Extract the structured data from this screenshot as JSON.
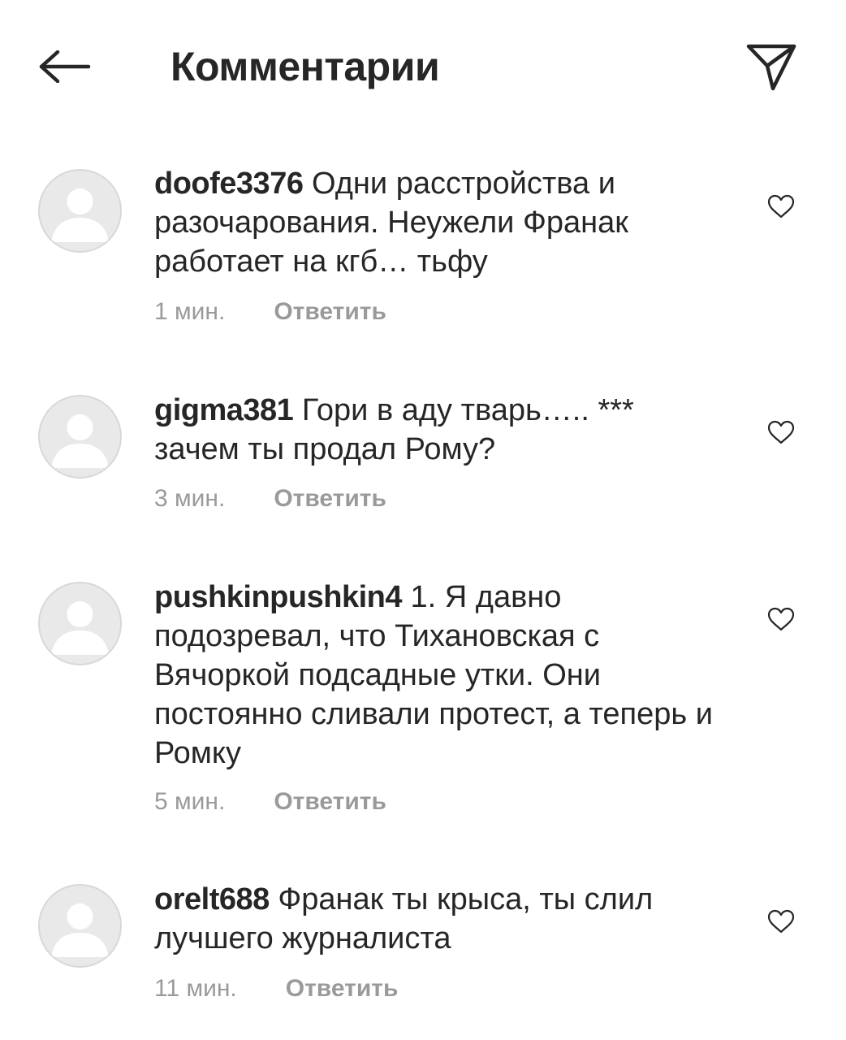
{
  "header": {
    "title": "Комментарии",
    "back_icon": "arrow-left-icon",
    "share_icon": "paper-plane-icon"
  },
  "comments": [
    {
      "username": "doofe3376",
      "text": "Одни расстройства и разочарования. Неужели Франак работает на кгб… тьфу",
      "time": "1 мин.",
      "reply_label": "Ответить"
    },
    {
      "username": "gigma381",
      "text": "Гори в аду тварь….. *** зачем ты продал Рому?",
      "time": "3 мин.",
      "reply_label": "Ответить"
    },
    {
      "username": "pushkinpushkin4",
      "text": "1.  Я давно подозревал, что Тихановская с Вячоркой подсадные утки. Они постоянно сливали протест, а теперь и Ромку",
      "time": "5 мин.",
      "reply_label": "Ответить"
    },
    {
      "username": "orelt688",
      "text": "Франак ты крыса, ты слил лучшего журналиста",
      "time": "11 мин.",
      "reply_label": "Ответить"
    }
  ],
  "colors": {
    "text": "#262626",
    "secondary_text": "#9a9a9a",
    "avatar_bg": "#e9e9e9",
    "avatar_figure": "#ffffff",
    "background": "#ffffff"
  }
}
